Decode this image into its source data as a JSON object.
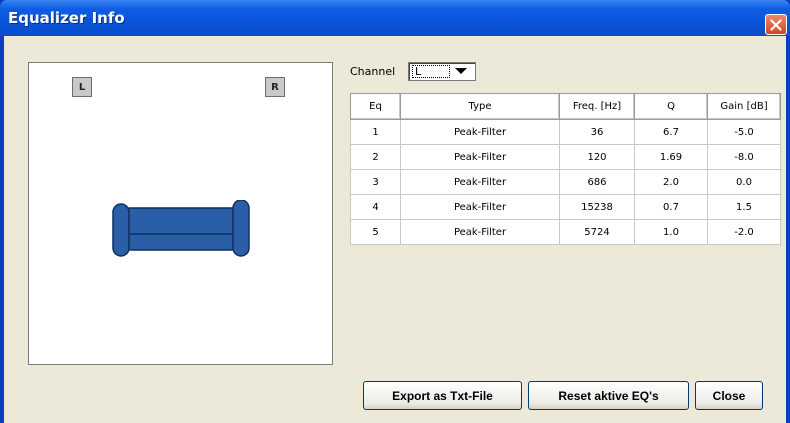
{
  "window": {
    "title": "Equalizer Info",
    "close_icon": "close-x-icon"
  },
  "speakers": {
    "left_label": "L",
    "right_label": "R",
    "listener_icon": "sofa-icon",
    "listener_color": "#2a5fa8"
  },
  "channel": {
    "label": "Channel",
    "selected": "L"
  },
  "table": {
    "headers": [
      "Eq",
      "Type",
      "Freq. [Hz]",
      "Q",
      "Gain [dB]"
    ],
    "rows": [
      [
        "1",
        "Peak-Filter",
        "36",
        "6.7",
        "-5.0"
      ],
      [
        "2",
        "Peak-Filter",
        "120",
        "1.69",
        "-8.0"
      ],
      [
        "3",
        "Peak-Filter",
        "686",
        "2.0",
        "0.0"
      ],
      [
        "4",
        "Peak-Filter",
        "15238",
        "0.7",
        "1.5"
      ],
      [
        "5",
        "Peak-Filter",
        "5724",
        "1.0",
        "-2.0"
      ]
    ]
  },
  "buttons": {
    "export": "Export as Txt-File",
    "reset": "Reset aktive EQ's",
    "close": "Close"
  }
}
